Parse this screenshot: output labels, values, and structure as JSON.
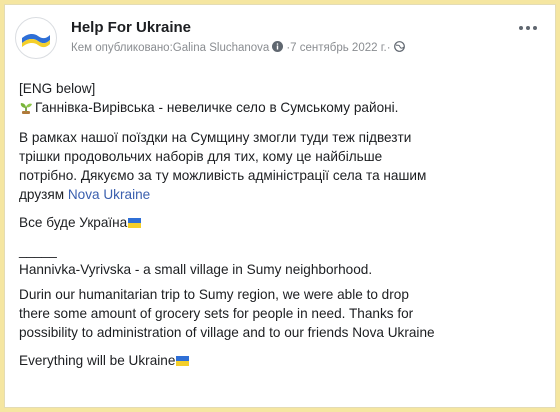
{
  "post": {
    "page_name": "Help For Ukraine",
    "published_by_prefix": "Кем опубликовано: ",
    "author": "Galina Sluchanova",
    "separator": " · ",
    "date": "7 сентябрь 2022 г.",
    "more_icon": "more-options-icon",
    "verified_icon": "info-badge-icon",
    "audience_icon": "globe-icon"
  },
  "content": {
    "line1": "[ENG below]",
    "line2": "Ганнівка-Вирівська - невеличке село в Сумському районі.",
    "para_ua": [
      "В рамках нашої поїздки на Сумщину змогли туди теж підвезти",
      "трішки продовольчих наборів для тих, кому це найбільше",
      "потрібно. Дякуємо за ту можливість адміністрації села та нашим"
    ],
    "para_ua_last_prefix": "друзям ",
    "link_text": "Nova Ukraine",
    "closing_ua": "Все буде Україна",
    "divider": "_____",
    "line_en_title": "Hannivka-Vyrivska - a small village in Sumy neighborhood.",
    "para_en": [
      "Durin our humanitarian trip to Sumy region, we were able to drop",
      "there some amount of grocery sets for people in need. Thanks for",
      "possibility to administration of village and to our friends Nova Ukraine"
    ],
    "closing_en": "Everything will be Ukraine",
    "flag_colors": {
      "top": "#2f6fd6",
      "bottom": "#f4cf2a"
    }
  }
}
